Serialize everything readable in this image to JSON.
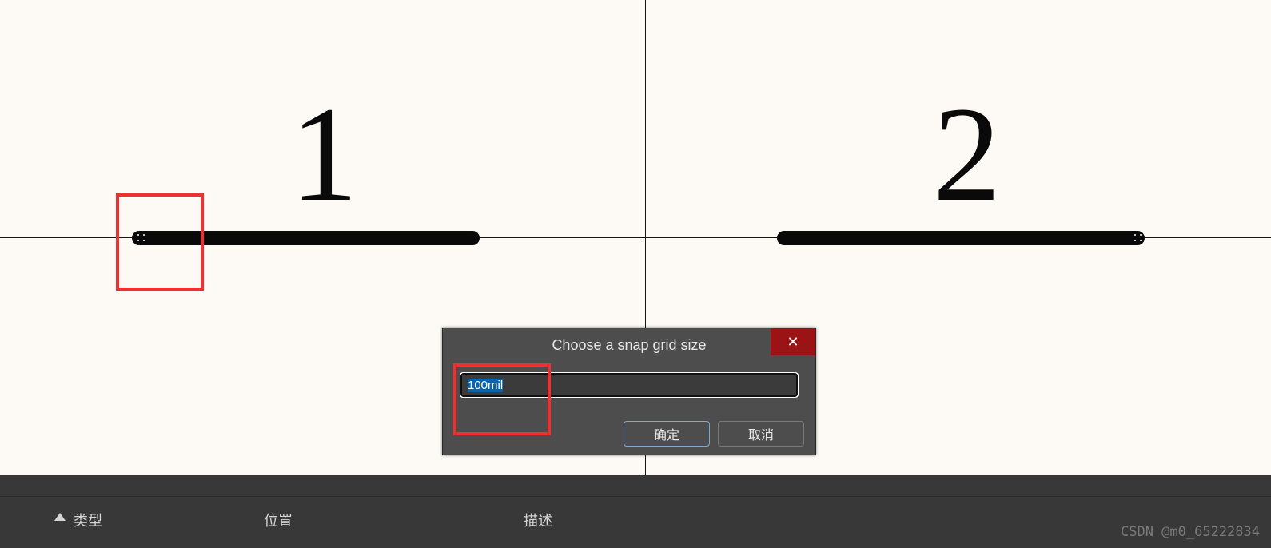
{
  "canvas": {
    "pin_labels": {
      "one": "1",
      "two": "2"
    }
  },
  "dialog": {
    "title": "Choose a snap grid size",
    "input_value": "100mil",
    "ok_label": "确定",
    "cancel_label": "取消",
    "close_glyph": "✕"
  },
  "panel": {
    "columns": {
      "type": "类型",
      "position": "位置",
      "description": "描述"
    }
  },
  "watermark": "CSDN @m0_65222834"
}
